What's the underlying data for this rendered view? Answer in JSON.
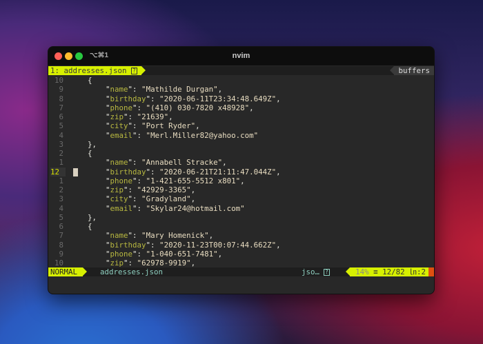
{
  "window": {
    "shortcut": "⌥⌘1",
    "title": "nvim"
  },
  "tabline": {
    "tab_label": "1: addresses.json",
    "tab_flag": "?",
    "buffers_label": "buffers"
  },
  "lines": [
    {
      "n": "10",
      "indent": 1,
      "text": "{"
    },
    {
      "n": "9",
      "indent": 2,
      "key": "name",
      "value": "Mathilde Durgan",
      "comma": ","
    },
    {
      "n": "8",
      "indent": 2,
      "key": "birthday",
      "value": "2020-06-11T23:34:48.649Z",
      "comma": ","
    },
    {
      "n": "7",
      "indent": 2,
      "key": "phone",
      "value": "(410) 030-7820 x48928",
      "comma": ","
    },
    {
      "n": "6",
      "indent": 2,
      "key": "zip",
      "value": "21639",
      "comma": ","
    },
    {
      "n": "5",
      "indent": 2,
      "key": "city",
      "value": "Port Ryder",
      "comma": ","
    },
    {
      "n": "4",
      "indent": 2,
      "key": "email",
      "value": "Merl.Miller82@yahoo.com",
      "comma": ""
    },
    {
      "n": "3",
      "indent": 1,
      "text": "},"
    },
    {
      "n": "2",
      "indent": 1,
      "text": "{"
    },
    {
      "n": "1",
      "indent": 2,
      "key": "name",
      "value": "Annabell Stracke",
      "comma": ","
    },
    {
      "n": "12",
      "indent": 2,
      "key": "birthday",
      "value": "2020-06-21T21:11:47.044Z",
      "comma": ",",
      "current": true
    },
    {
      "n": "1",
      "indent": 2,
      "key": "phone",
      "value": "1-421-655-5512 x801",
      "comma": ","
    },
    {
      "n": "2",
      "indent": 2,
      "key": "zip",
      "value": "42929-3365",
      "comma": ","
    },
    {
      "n": "3",
      "indent": 2,
      "key": "city",
      "value": "Gradyland",
      "comma": ","
    },
    {
      "n": "4",
      "indent": 2,
      "key": "email",
      "value": "Skylar24@hotmail.com",
      "comma": ""
    },
    {
      "n": "5",
      "indent": 1,
      "text": "},"
    },
    {
      "n": "6",
      "indent": 1,
      "text": "{"
    },
    {
      "n": "7",
      "indent": 2,
      "key": "name",
      "value": "Mary Homenick",
      "comma": ","
    },
    {
      "n": "8",
      "indent": 2,
      "key": "birthday",
      "value": "2020-11-23T00:07:44.662Z",
      "comma": ","
    },
    {
      "n": "9",
      "indent": 2,
      "key": "phone",
      "value": "1-040-651-7481",
      "comma": ","
    },
    {
      "n": "10",
      "indent": 2,
      "key": "zip",
      "value": "62978-9919",
      "comma": ","
    }
  ],
  "statusline": {
    "mode": "NORMAL",
    "filename": "addresses.json",
    "filetype": "jso…",
    "flag": "?",
    "percent": "14%",
    "position": "≡ 12/82",
    "column": "㏑:2"
  },
  "colors": {
    "accent": "#d7f000",
    "key": "#b8b840",
    "string": "#e8dcc0"
  }
}
